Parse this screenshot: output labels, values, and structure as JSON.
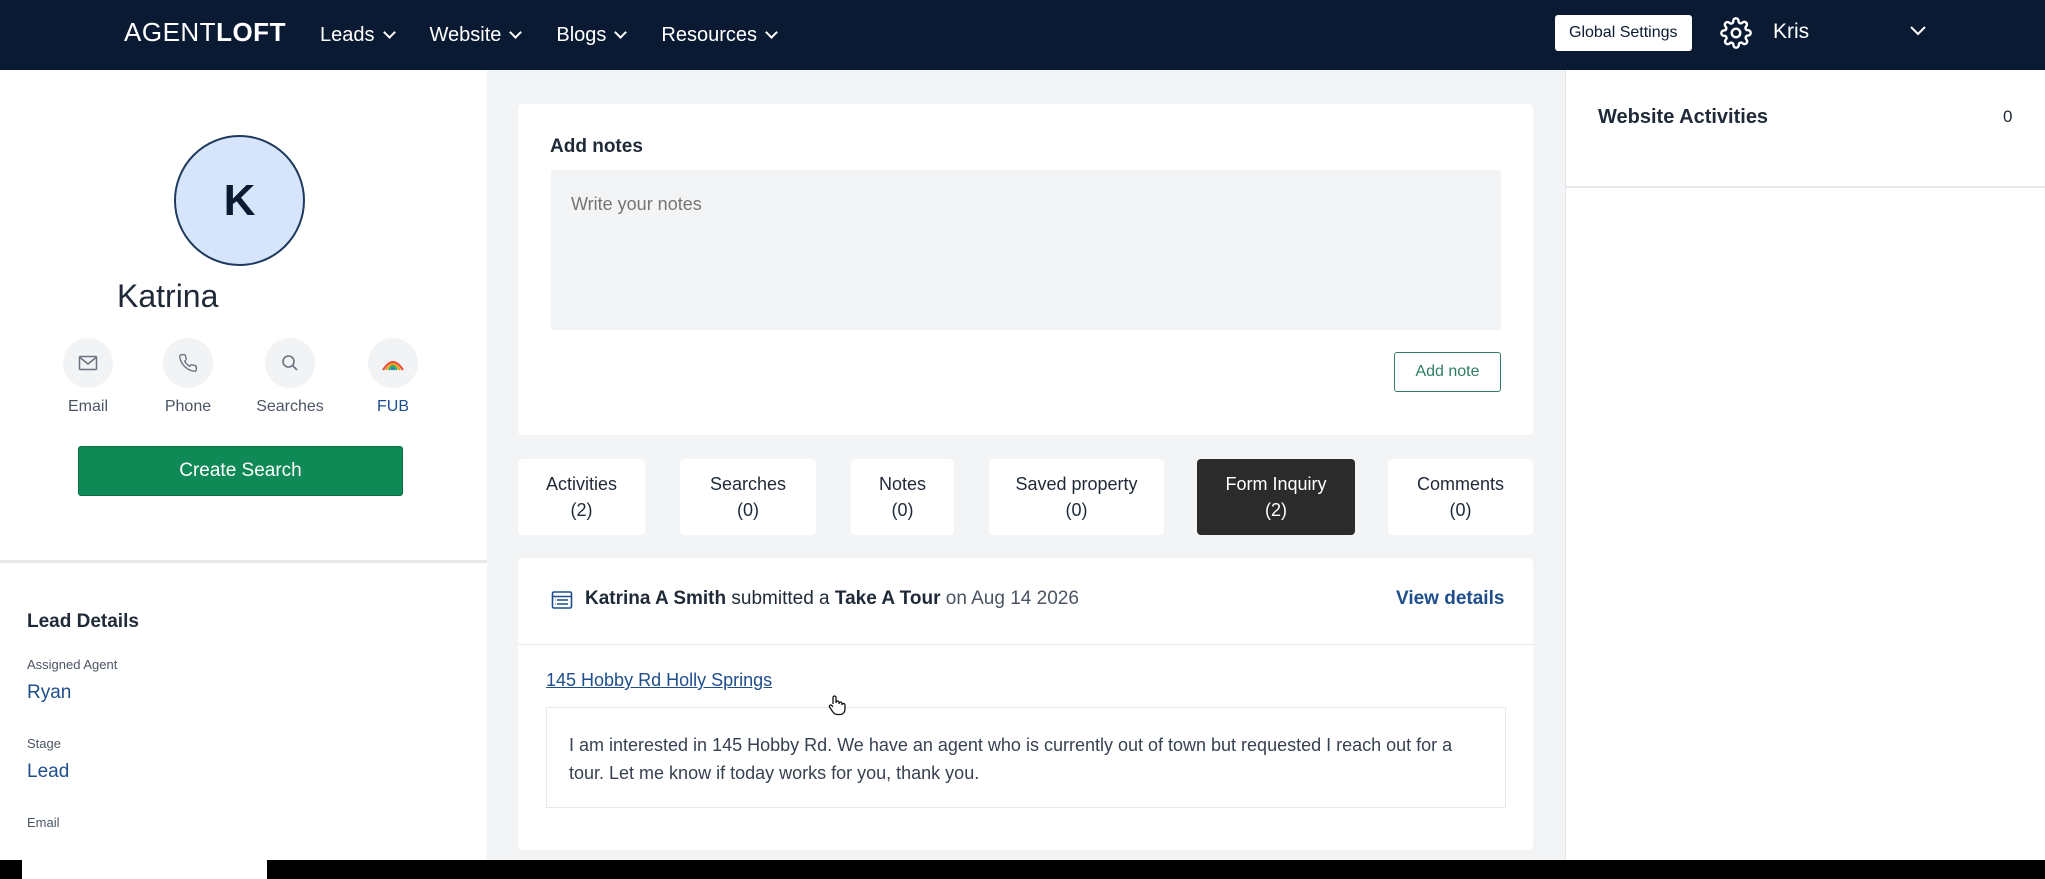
{
  "brand": {
    "logo_light": "AGENT",
    "logo_bold": "LOFT"
  },
  "nav": {
    "items": [
      {
        "label": "Leads"
      },
      {
        "label": "Website"
      },
      {
        "label": "Blogs"
      },
      {
        "label": "Resources"
      }
    ],
    "global_settings": "Global Settings",
    "user": "Kris",
    "icons": {
      "settings": "gear-icon",
      "user_menu": "chevron-down-icon"
    }
  },
  "profile": {
    "initial": "K",
    "name": "Katrina",
    "actions": [
      {
        "label": "Email",
        "icon": "mail-icon"
      },
      {
        "label": "Phone",
        "icon": "phone-icon"
      },
      {
        "label": "Searches",
        "icon": "search-icon"
      },
      {
        "label": "FUB",
        "icon": "fub-logo-icon"
      }
    ],
    "create_search": "Create Search"
  },
  "lead_details": {
    "title": "Lead Details",
    "fields": [
      {
        "label": "Assigned Agent",
        "value": "Ryan"
      },
      {
        "label": "Stage",
        "value": "Lead"
      },
      {
        "label": "Email",
        "value": ""
      }
    ]
  },
  "notes": {
    "title": "Add notes",
    "placeholder": "Write your notes",
    "add_button": "Add note"
  },
  "tabs": [
    {
      "label": "Activities",
      "count": "(2)"
    },
    {
      "label": "Searches",
      "count": "(0)"
    },
    {
      "label": "Notes",
      "count": "(0)"
    },
    {
      "label": "Saved property",
      "count": "(0)"
    },
    {
      "label": "Form Inquiry",
      "count": "(2)",
      "active": true
    },
    {
      "label": "Comments",
      "count": "(0)"
    }
  ],
  "inquiry": {
    "name": "Katrina A Smith",
    "verb": "submitted a",
    "form": "Take A Tour",
    "on": "on Aug 14 2026",
    "view_details": "View details",
    "address": "145 Hobby Rd Holly Springs",
    "message": "I am interested in 145 Hobby Rd. We have an agent who is currently out of town but requested I reach out for a tour. Let me know if today works for you, thank you."
  },
  "website_activities": {
    "title": "Website Activities",
    "count": "0"
  },
  "colors": {
    "nav_bg": "#0b1a33",
    "primary_green": "#0f8a56",
    "link_blue": "#1e4e8c",
    "active_tab": "#2b2b2b"
  }
}
